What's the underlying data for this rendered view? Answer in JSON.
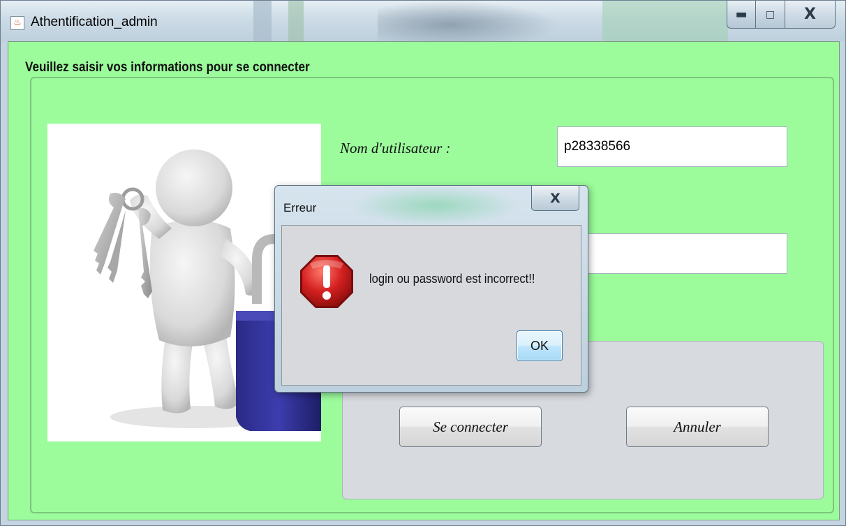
{
  "window": {
    "title": "Athentification_admin"
  },
  "form": {
    "panel_title": "Veuillez saisir vos informations pour se connecter",
    "username_label": "Nom d'utilisateur :",
    "username_value": "p28338566",
    "password_value": "****",
    "connect_label": "Se connecter",
    "cancel_label": "Annuler"
  },
  "dialog": {
    "title": "Erreur",
    "message": "login ou password est incorrect!!",
    "ok_label": "OK",
    "icon": "error-stop-icon"
  },
  "icons": {
    "app": "java-icon",
    "minimize": "minimize-icon",
    "maximize": "maximize-icon",
    "close": "close-icon"
  },
  "colors": {
    "client_background": "#9cfc9c",
    "error_red": "#d42020"
  }
}
